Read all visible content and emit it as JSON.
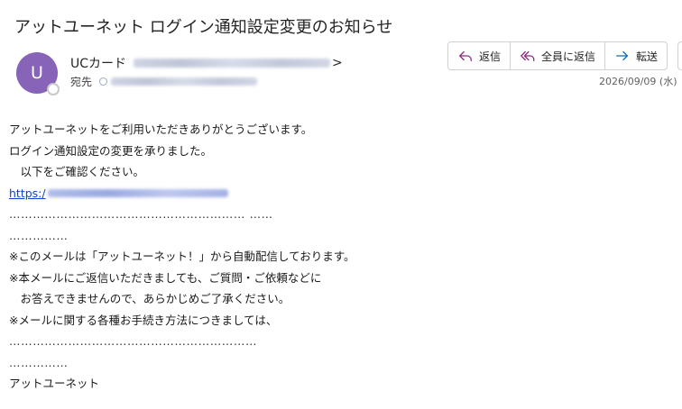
{
  "email": {
    "subject": "アットユーネット  ログイン通知設定変更のお知らせ",
    "sender": {
      "avatar_initial": "U",
      "name": "UCカード",
      "address_close": ">"
    },
    "to_label": "宛先",
    "date": "2026/09/09 (水)"
  },
  "actions": {
    "reply": "返信",
    "reply_all": "全員に返信",
    "forward": "転送"
  },
  "body": {
    "line1": "アットユーネットをご利用いただきありがとうございます。",
    "line2": "ログイン通知設定の変更を承りました。",
    "line3": "　以下をご確認ください。",
    "link_prefix": "https:/",
    "dots1": "…………………………………………………… ……",
    "dots2": "……………",
    "line4": "※このメールは「アットユーネット！」から自動配信しております。",
    "line5": "※本メールにご返信いただきましても、ご質問・ご依頼などに",
    "line6": "　お答えできませんので、あらかじめご了承ください。",
    "line7": "※メールに関する各種お手続き方法につきましては、",
    "dots3": "………………………………………………………",
    "dots4": "……………",
    "signature": "アットユーネット"
  },
  "colors": {
    "avatar": "#8764b8",
    "link": "#0b46c8",
    "icon_accent": "#8a2b7e",
    "forward_icon": "#0f6cbd"
  }
}
